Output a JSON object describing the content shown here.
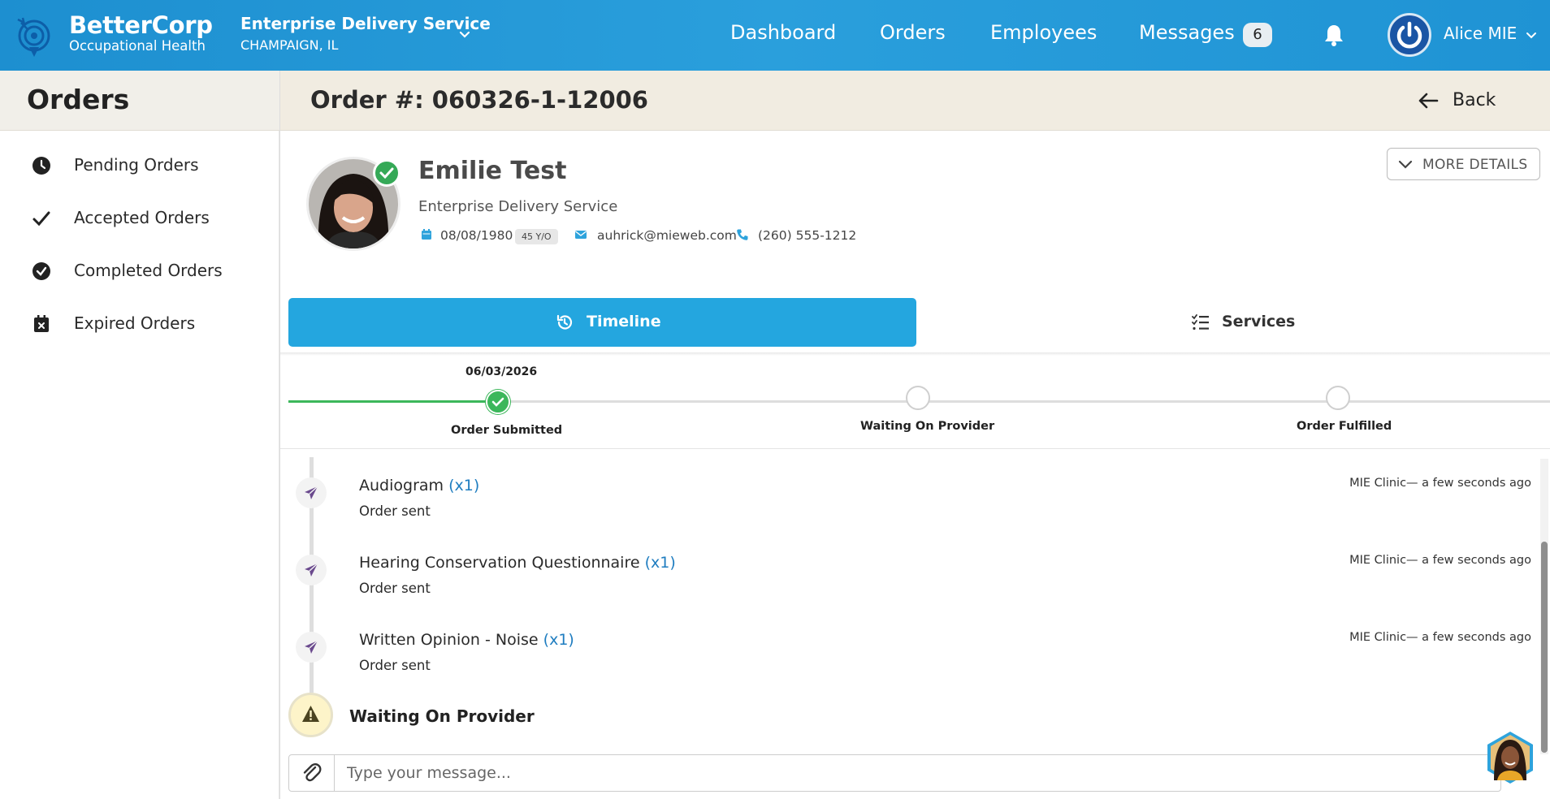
{
  "header": {
    "brand_name": "BetterCorp",
    "brand_sub": "Occupational Health",
    "org_name": "Enterprise Delivery Service",
    "org_location": "CHAMPAIGN, IL",
    "nav": [
      "Dashboard",
      "Orders",
      "Employees",
      "Messages"
    ],
    "messages_count": "6",
    "user_name": "Alice MIE"
  },
  "sidebar": {
    "title": "Orders",
    "items": [
      {
        "label": "Pending Orders",
        "icon": "clock-icon"
      },
      {
        "label": "Accepted Orders",
        "icon": "check-icon"
      },
      {
        "label": "Completed Orders",
        "icon": "check-circle-icon"
      },
      {
        "label": "Expired Orders",
        "icon": "calendar-x-icon"
      }
    ]
  },
  "order": {
    "title": "Order #: 060326-1-12006",
    "back_label": "Back",
    "more_details_label": "MORE DETAILS"
  },
  "patient": {
    "name": "Emilie Test",
    "organization": "Enterprise Delivery Service",
    "dob": "08/08/1980",
    "age": "45 Y/O",
    "email": "auhrick@mieweb.com",
    "phone": "(260) 555-1212"
  },
  "tabs": {
    "timeline": "Timeline",
    "services": "Services"
  },
  "progress": {
    "steps": [
      {
        "label": "Order Submitted",
        "date": "06/03/2026",
        "done": true
      },
      {
        "label": "Waiting On Provider",
        "date": "",
        "done": false
      },
      {
        "label": "Order Fulfilled",
        "date": "",
        "done": false
      }
    ]
  },
  "timeline": {
    "events": [
      {
        "title": "Audiogram",
        "qty": "(x1)",
        "status": "Order sent",
        "meta": "MIE Clinic— a few seconds ago"
      },
      {
        "title": "Hearing Conservation Questionnaire",
        "qty": "(x1)",
        "status": "Order sent",
        "meta": "MIE Clinic— a few seconds ago"
      },
      {
        "title": "Written Opinion - Noise",
        "qty": "(x1)",
        "status": "Order sent",
        "meta": "MIE Clinic— a few seconds ago"
      }
    ],
    "current_status": "Waiting On Provider"
  },
  "message": {
    "placeholder": "Type your message..."
  },
  "colors": {
    "header_blue": "#2a9fdc",
    "tab_active": "#24a6df",
    "success_green": "#3cb75b",
    "event_icon_purple": "#6b4a8e",
    "link_blue": "#1f7dc0"
  }
}
